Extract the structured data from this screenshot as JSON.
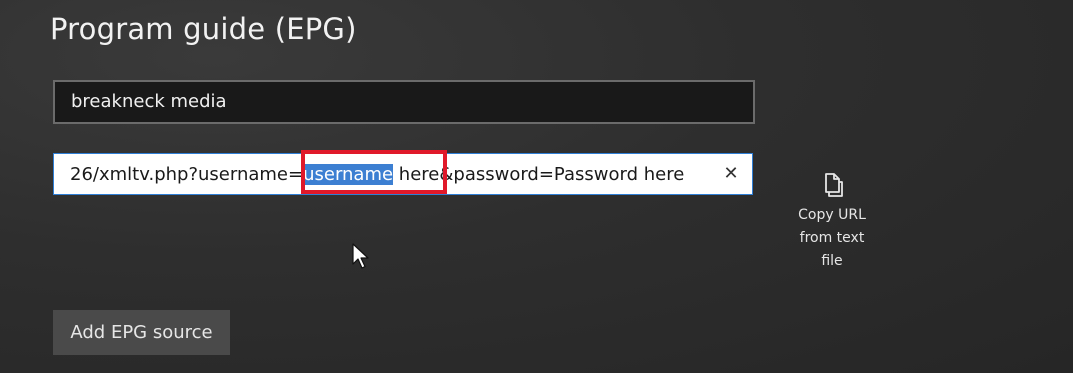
{
  "page": {
    "title": "Program guide (EPG)"
  },
  "name_field": {
    "value": "breakneck media"
  },
  "url_field": {
    "value_before": "26/xmltv.php?username=",
    "value_selected": "username",
    "value_after": " here&password=Password here",
    "clear_icon": "close-icon",
    "clear_glyph": "✕"
  },
  "copy_button": {
    "icon": "copy-icon",
    "label_line1": "Copy URL",
    "label_line2": "from text",
    "label_line3": "file"
  },
  "add_button": {
    "label": "Add EPG source"
  },
  "colors": {
    "selection": "#3c7fd2",
    "highlight_box": "#e0192a",
    "focus_border": "#2f7fd6"
  }
}
